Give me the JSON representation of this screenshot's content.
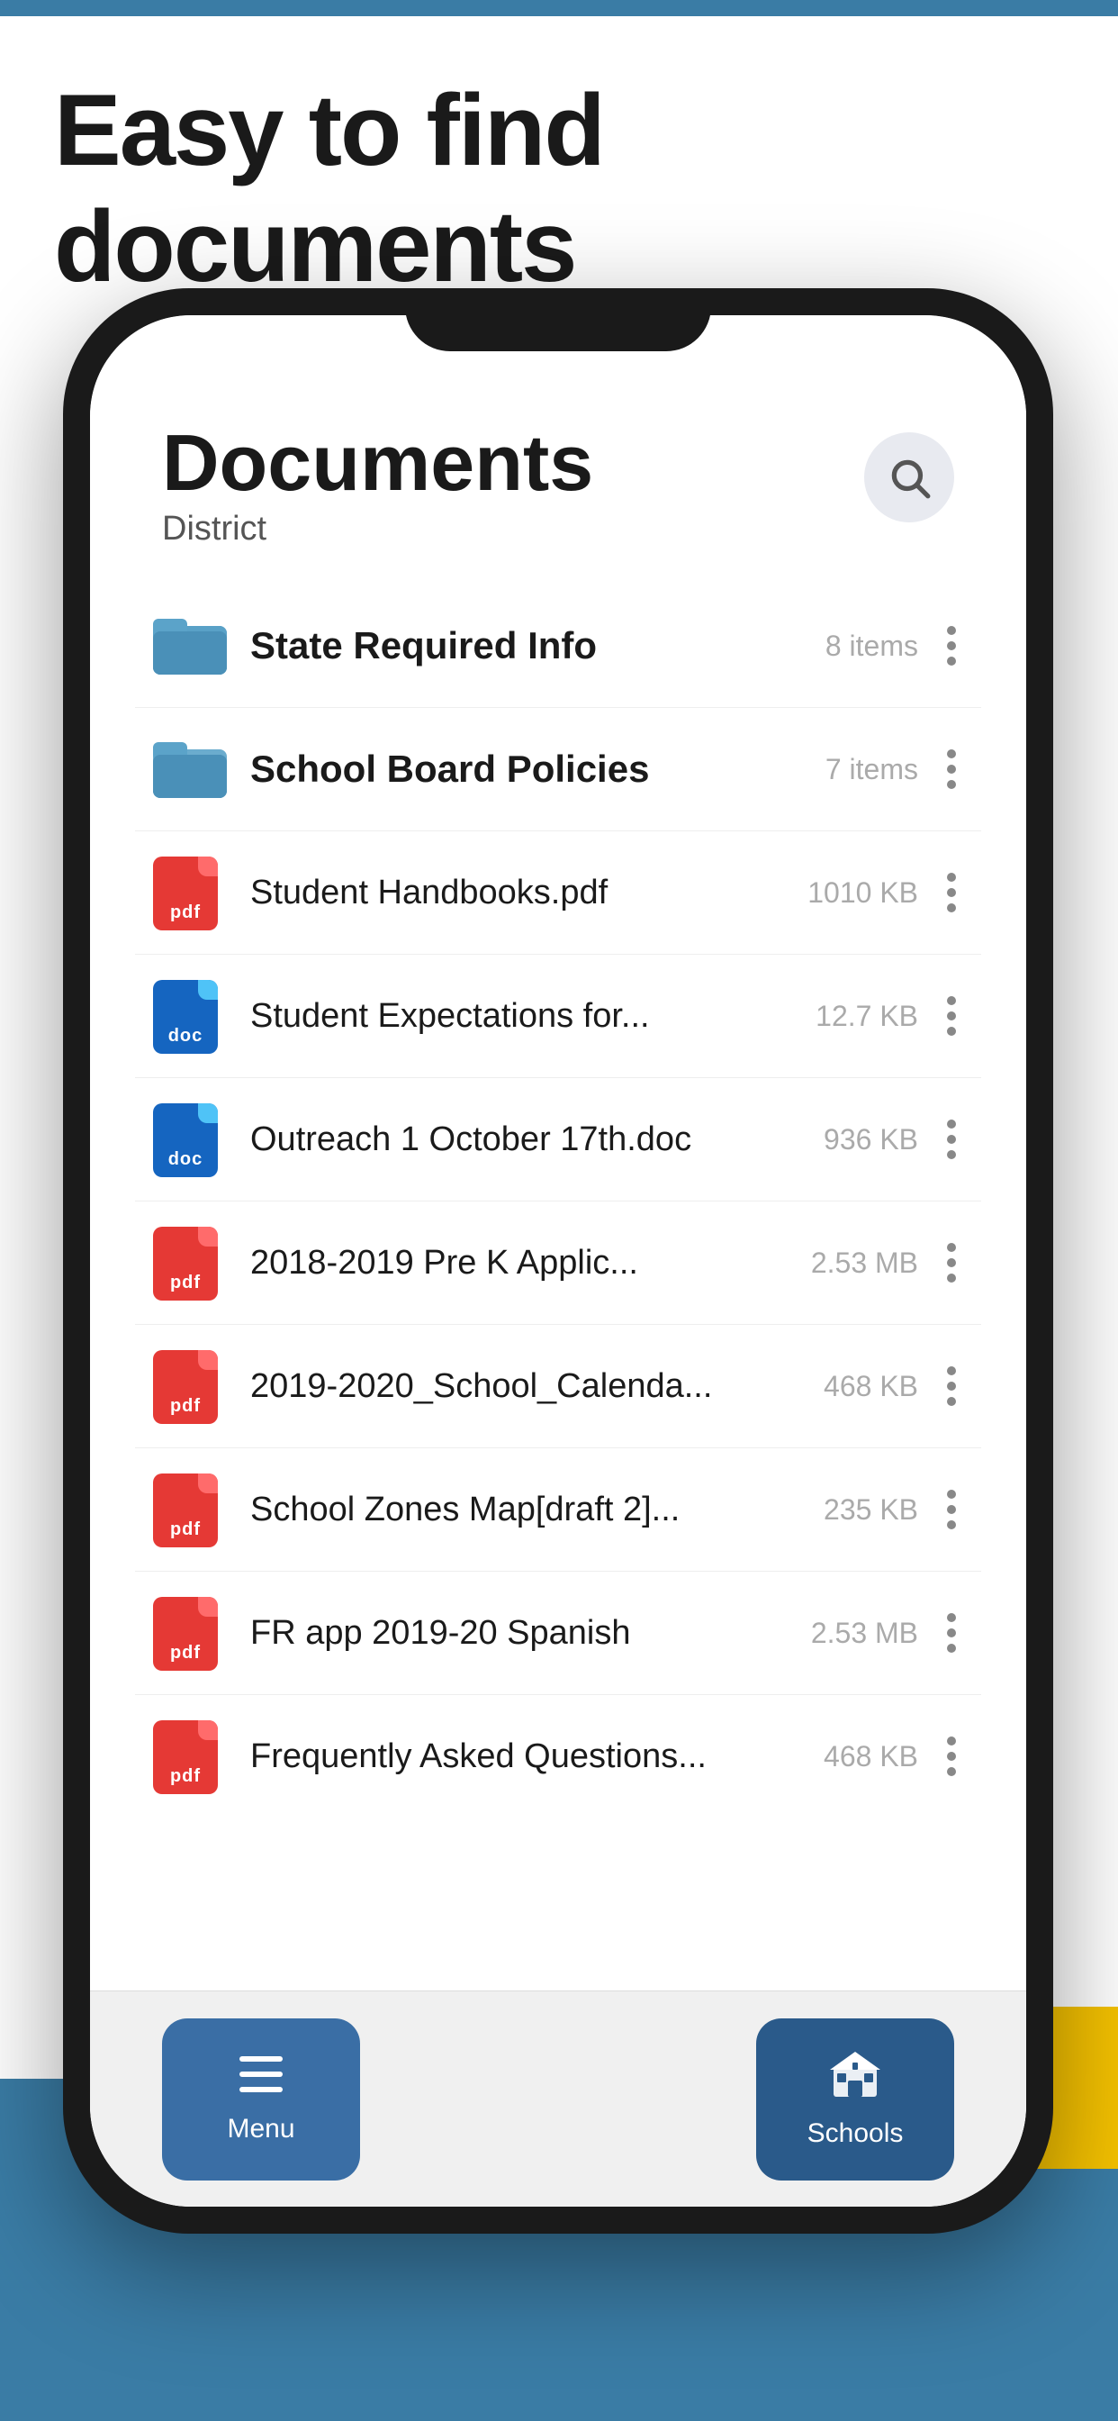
{
  "page": {
    "title": "Easy to find documents",
    "bg_stripe_color": "#3A7CA5",
    "bg_teal_color": "#3A6EA5",
    "bg_yellow_color": "#F5C200"
  },
  "phone": {
    "header": {
      "title": "Documents",
      "subtitle": "District",
      "search_aria": "Search"
    },
    "items": [
      {
        "id": "state-required",
        "type": "folder",
        "name": "State Required Info",
        "size": "8 items",
        "bold": true
      },
      {
        "id": "school-board",
        "type": "folder",
        "name": "School Board Policies",
        "size": "7 items",
        "bold": true
      },
      {
        "id": "student-handbooks",
        "type": "pdf",
        "name": "Student Handbooks.pdf",
        "size": "1010 KB",
        "bold": false
      },
      {
        "id": "student-expectations",
        "type": "doc",
        "name": "Student Expectations for...",
        "size": "12.7 KB",
        "bold": false
      },
      {
        "id": "outreach",
        "type": "doc",
        "name": "Outreach 1 October 17th.doc",
        "size": "936 KB",
        "bold": false
      },
      {
        "id": "pre-k-app",
        "type": "pdf",
        "name": "2018-2019 Pre K Applic...",
        "size": "2.53 MB",
        "bold": false
      },
      {
        "id": "school-calendar",
        "type": "pdf",
        "name": "2019-2020_School_Calenda...",
        "size": "468 KB",
        "bold": false
      },
      {
        "id": "school-zones",
        "type": "pdf",
        "name": "School Zones Map[draft 2]...",
        "size": "235 KB",
        "bold": false
      },
      {
        "id": "fr-app-spanish",
        "type": "pdf",
        "name": "FR app 2019-20 Spanish",
        "size": "2.53 MB",
        "bold": false
      },
      {
        "id": "faq",
        "type": "pdf",
        "name": "Frequently Asked Questions...",
        "size": "468 KB",
        "bold": false
      }
    ],
    "tabs": [
      {
        "id": "menu",
        "label": "Menu",
        "icon": "☰",
        "active": false
      },
      {
        "id": "schools",
        "label": "Schools",
        "icon": "🏛",
        "active": true
      }
    ]
  }
}
